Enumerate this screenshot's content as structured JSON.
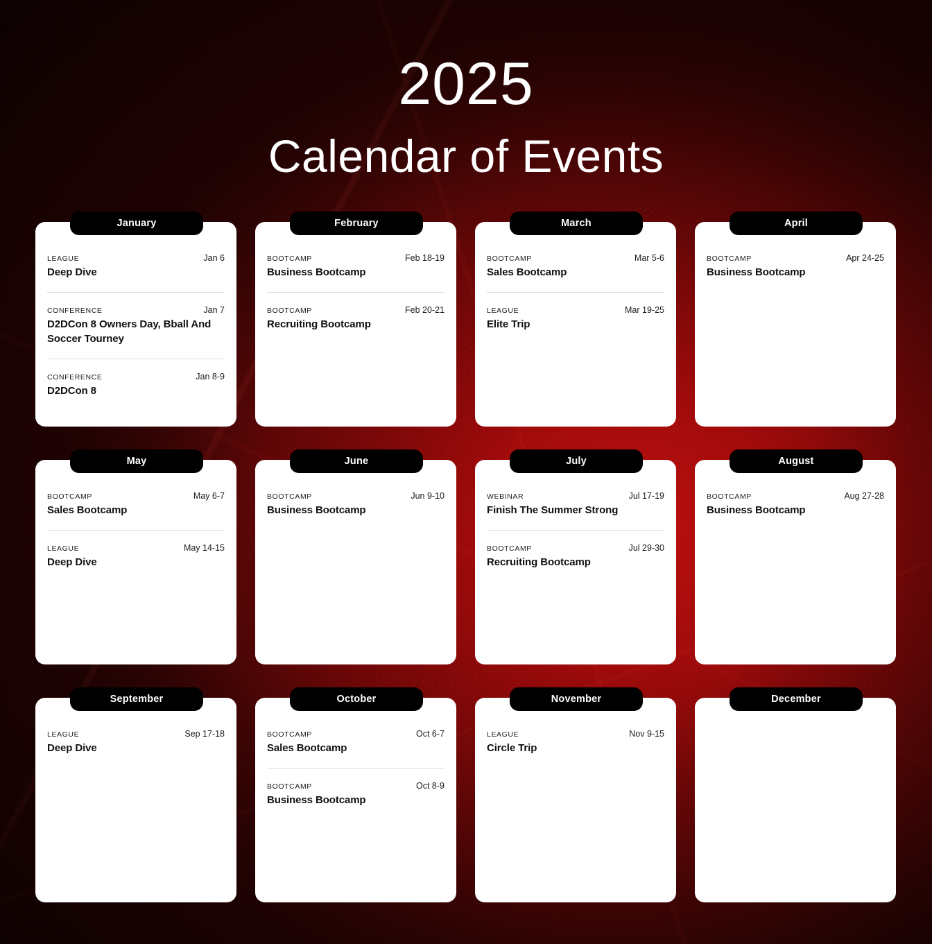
{
  "header": {
    "year": "2025",
    "title": "Calendar of Events"
  },
  "theme": {
    "background_red_bright": "#b50808",
    "background_red_dark": "#3a0404",
    "card_bg": "#ffffff",
    "tab_bg": "#000000",
    "tab_text": "#ffffff",
    "text_color": "#111111",
    "divider": "#dcdcdc"
  },
  "months": [
    {
      "name": "January",
      "events": [
        {
          "category": "LEAGUE",
          "date": "Jan 6",
          "title": "Deep Dive"
        },
        {
          "category": "CONFERENCE",
          "date": "Jan 7",
          "title": "D2DCon 8 Owners Day, Bball And Soccer Tourney"
        },
        {
          "category": "CONFERENCE",
          "date": "Jan 8-9",
          "title": "D2DCon 8"
        }
      ]
    },
    {
      "name": "February",
      "events": [
        {
          "category": "BOOTCAMP",
          "date": "Feb 18-19",
          "title": "Business Bootcamp"
        },
        {
          "category": "BOOTCAMP",
          "date": "Feb 20-21",
          "title": "Recruiting Bootcamp"
        }
      ]
    },
    {
      "name": "March",
      "events": [
        {
          "category": "BOOTCAMP",
          "date": "Mar 5-6",
          "title": "Sales Bootcamp"
        },
        {
          "category": "LEAGUE",
          "date": "Mar 19-25",
          "title": "Elite Trip"
        }
      ]
    },
    {
      "name": "April",
      "events": [
        {
          "category": "BOOTCAMP",
          "date": "Apr 24-25",
          "title": "Business Bootcamp"
        }
      ]
    },
    {
      "name": "May",
      "events": [
        {
          "category": "BOOTCAMP",
          "date": "May 6-7",
          "title": "Sales Bootcamp"
        },
        {
          "category": "LEAGUE",
          "date": "May 14-15",
          "title": "Deep Dive"
        }
      ]
    },
    {
      "name": "June",
      "events": [
        {
          "category": "BOOTCAMP",
          "date": "Jun 9-10",
          "title": "Business Bootcamp"
        }
      ]
    },
    {
      "name": "July",
      "events": [
        {
          "category": "WEBINAR",
          "date": "Jul 17-19",
          "title": "Finish The Summer Strong"
        },
        {
          "category": "BOOTCAMP",
          "date": "Jul 29-30",
          "title": "Recruiting Bootcamp"
        }
      ]
    },
    {
      "name": "August",
      "events": [
        {
          "category": "BOOTCAMP",
          "date": "Aug 27-28",
          "title": "Business Bootcamp"
        }
      ]
    },
    {
      "name": "September",
      "events": [
        {
          "category": "LEAGUE",
          "date": "Sep 17-18",
          "title": "Deep Dive"
        }
      ]
    },
    {
      "name": "October",
      "events": [
        {
          "category": "BOOTCAMP",
          "date": "Oct 6-7",
          "title": "Sales Bootcamp"
        },
        {
          "category": "BOOTCAMP",
          "date": "Oct 8-9",
          "title": "Business Bootcamp"
        }
      ]
    },
    {
      "name": "November",
      "events": [
        {
          "category": "LEAGUE",
          "date": "Nov 9-15",
          "title": "Circle Trip"
        }
      ]
    },
    {
      "name": "December",
      "events": []
    }
  ]
}
